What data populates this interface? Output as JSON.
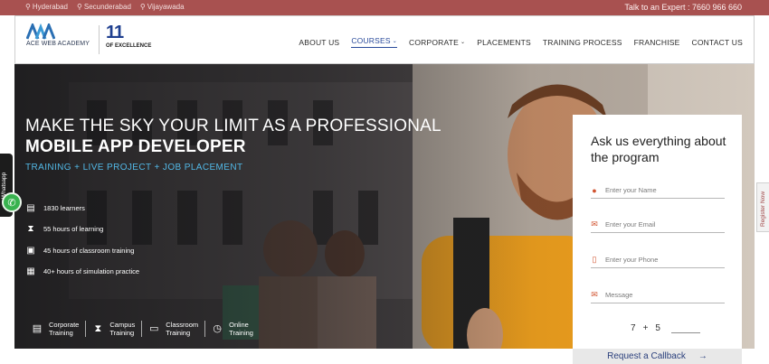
{
  "topbar": {
    "locations": [
      "Hyderabad",
      "Secunderabad",
      "Vijayawada"
    ],
    "expert_text": "Talk to an Expert : 7660 966 660"
  },
  "header": {
    "logo_text": "ACE WEB ACADEMY",
    "badge_number": "11",
    "badge_text": "OF EXCELLENCE",
    "nav": [
      {
        "label": "ABOUT US",
        "has_caret": false,
        "active": false
      },
      {
        "label": "COURSES",
        "has_caret": true,
        "active": true
      },
      {
        "label": "CORPORATE",
        "has_caret": true,
        "active": false
      },
      {
        "label": "PLACEMENTS",
        "has_caret": false,
        "active": false
      },
      {
        "label": "TRAINING PROCESS",
        "has_caret": false,
        "active": false
      },
      {
        "label": "FRANCHISE",
        "has_caret": false,
        "active": false
      },
      {
        "label": "CONTACT US",
        "has_caret": false,
        "active": false
      }
    ]
  },
  "hero": {
    "headline_plain": "MAKE THE SKY YOUR LIMIT AS A PROFESSIONAL ",
    "headline_bold": "MOBILE APP DEVELOPER",
    "tagline": "TRAINING + LIVE PROJECT + JOB PLACEMENT",
    "stats": [
      {
        "icon": "certificate-icon",
        "text": "1830 learners"
      },
      {
        "icon": "hourglass-icon",
        "text": "55 hours of learning"
      },
      {
        "icon": "classroom-icon",
        "text": "45 hours of classroom training"
      },
      {
        "icon": "simulation-icon",
        "text": "40+ hours of simulation practice"
      }
    ],
    "modes": [
      {
        "icon": "corporate-icon",
        "line1": "Corporate",
        "line2": "Training"
      },
      {
        "icon": "hourglass-icon",
        "line1": "Campus",
        "line2": "Training"
      },
      {
        "icon": "monitor-icon",
        "line1": "Classroom",
        "line2": "Training"
      },
      {
        "icon": "clock-icon",
        "line1": "Online",
        "line2": "Training"
      }
    ]
  },
  "side": {
    "whatsapp_label": "Whatsapp",
    "register_label": "Register Now"
  },
  "form": {
    "title": "Ask us everything about the program",
    "name_placeholder": "Enter your Name",
    "email_placeholder": "Enter your Email",
    "phone_placeholder": "Enter your Phone",
    "message_placeholder": "Message",
    "captcha_a": "7",
    "captcha_op": "+",
    "captcha_b": "5",
    "submit_label": "Request a Callback"
  },
  "colors": {
    "topbar": "#a85150",
    "brand_blue": "#2a4b9b",
    "tagline": "#52b8e6",
    "form_icon": "#d1532f"
  }
}
